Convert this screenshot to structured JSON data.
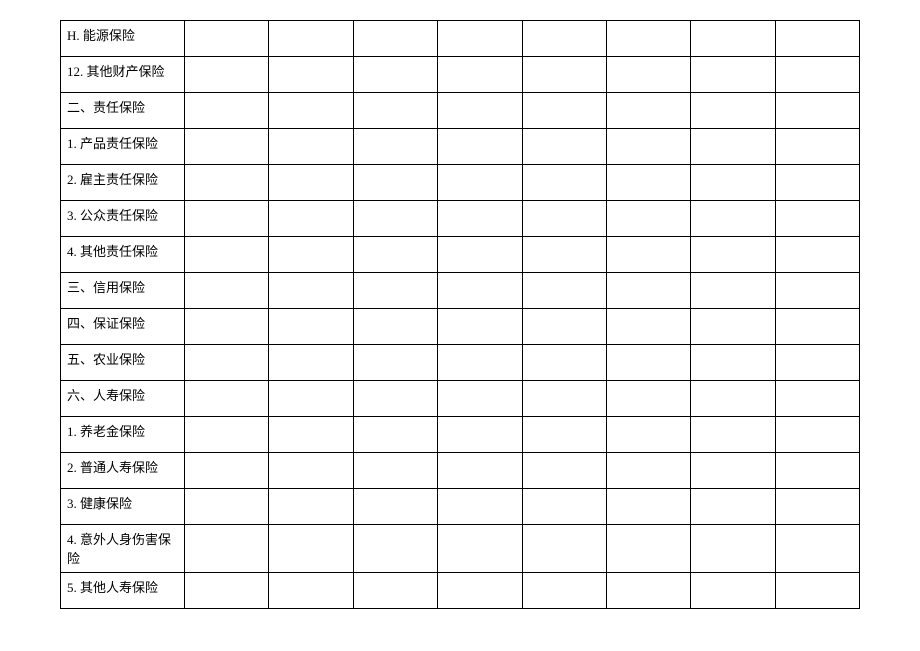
{
  "rows": [
    {
      "label": "H. 能源保险",
      "cells": [
        "",
        "",
        "",
        "",
        "",
        "",
        "",
        ""
      ]
    },
    {
      "label": "12. 其他财产保险",
      "cells": [
        "",
        "",
        "",
        "",
        "",
        "",
        "",
        ""
      ]
    },
    {
      "label": "二、责任保险",
      "cells": [
        "",
        "",
        "",
        "",
        "",
        "",
        "",
        ""
      ]
    },
    {
      "label": "1. 产品责任保险",
      "cells": [
        "",
        "",
        "",
        "",
        "",
        "",
        "",
        ""
      ]
    },
    {
      "label": "2. 雇主责任保险",
      "cells": [
        "",
        "",
        "",
        "",
        "",
        "",
        "",
        ""
      ]
    },
    {
      "label": "3. 公众责任保险",
      "cells": [
        "",
        "",
        "",
        "",
        "",
        "",
        "",
        ""
      ]
    },
    {
      "label": "4. 其他责任保险",
      "cells": [
        "",
        "",
        "",
        "",
        "",
        "",
        "",
        ""
      ]
    },
    {
      "label": "三、信用保险",
      "cells": [
        "",
        "",
        "",
        "",
        "",
        "",
        "",
        ""
      ]
    },
    {
      "label": "四、保证保险",
      "cells": [
        "",
        "",
        "",
        "",
        "",
        "",
        "",
        ""
      ]
    },
    {
      "label": "五、农业保险",
      "cells": [
        "",
        "",
        "",
        "",
        "",
        "",
        "",
        ""
      ]
    },
    {
      "label": "六、人寿保险",
      "cells": [
        "",
        "",
        "",
        "",
        "",
        "",
        "",
        ""
      ]
    },
    {
      "label": "1. 养老金保险",
      "cells": [
        "",
        "",
        "",
        "",
        "",
        "",
        "",
        ""
      ]
    },
    {
      "label": "2. 普通人寿保险",
      "cells": [
        "",
        "",
        "",
        "",
        "",
        "",
        "",
        ""
      ]
    },
    {
      "label": "3. 健康保险",
      "cells": [
        "",
        "",
        "",
        "",
        "",
        "",
        "",
        ""
      ]
    },
    {
      "label": "4. 意外人身伤害保险",
      "cells": [
        "",
        "",
        "",
        "",
        "",
        "",
        "",
        ""
      ],
      "tall": true
    },
    {
      "label": "5. 其他人寿保险",
      "cells": [
        "",
        "",
        "",
        "",
        "",
        "",
        "",
        ""
      ]
    }
  ]
}
